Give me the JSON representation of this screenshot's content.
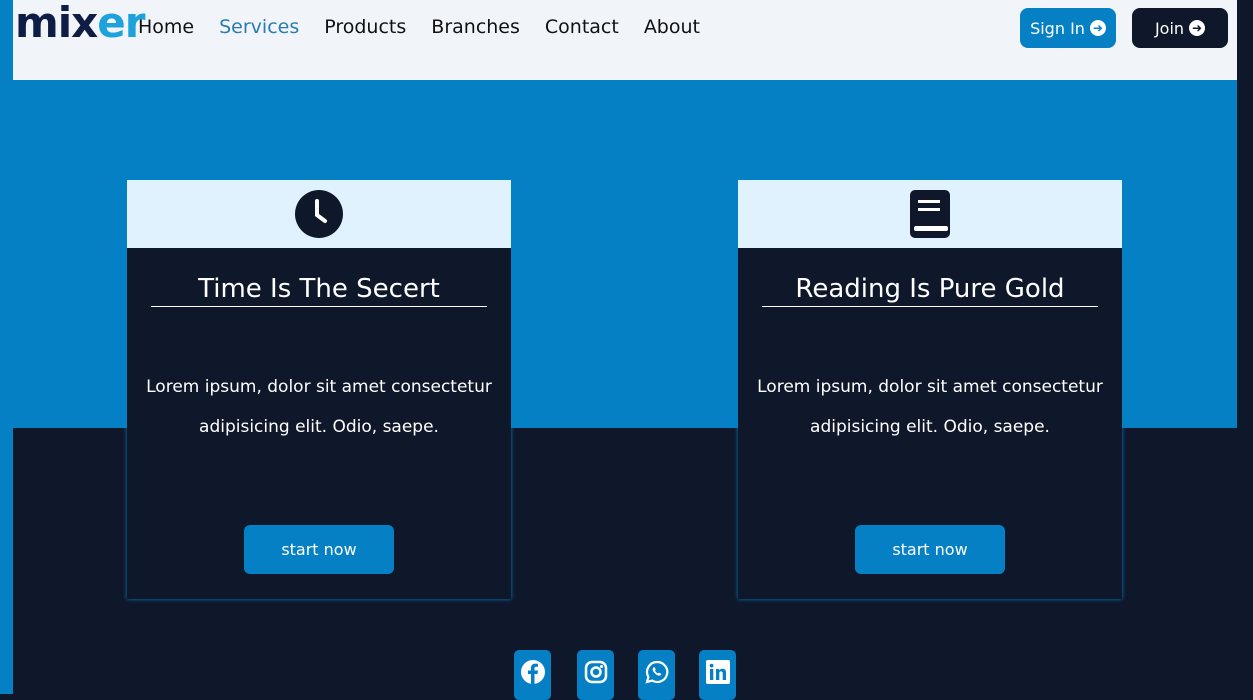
{
  "brand": {
    "logo_a": "mi",
    "logo_b": "x",
    "logo_c": "er"
  },
  "nav": {
    "links": [
      "Home",
      "Services",
      "Products",
      "Branches",
      "Contact",
      "About"
    ],
    "active": "Services",
    "sign_in": "Sign In",
    "join": "Join"
  },
  "cards": [
    {
      "icon": "clock-icon",
      "title": "Time Is The Secert",
      "text": "Lorem ipsum, dolor sit amet consectetur adipisicing elit. Odio, saepe.",
      "button": "start now"
    },
    {
      "icon": "book-icon",
      "title": "Reading Is Pure Gold",
      "text": "Lorem ipsum, dolor sit amet consectetur adipisicing elit. Odio, saepe.",
      "button": "start now"
    }
  ],
  "social": [
    "facebook-icon",
    "instagram-icon",
    "whatsapp-icon",
    "linkedin-icon"
  ],
  "colors": {
    "primary": "#0580c5",
    "dark": "#0f172a",
    "light": "#f1f5f9"
  }
}
